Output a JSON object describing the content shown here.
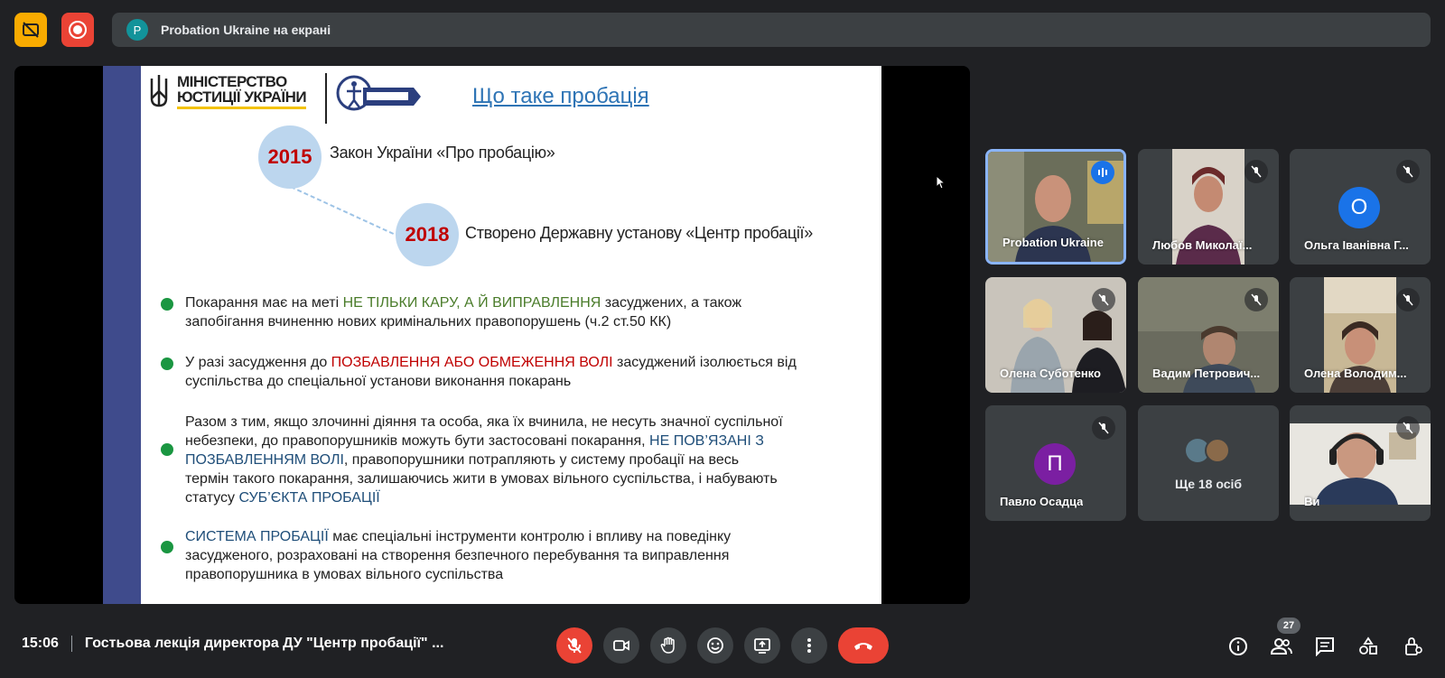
{
  "top_bar": {
    "presenter_initial": "P",
    "presenting_text": "Probation Ukraine на екрані"
  },
  "slide": {
    "ministry_line1": "МІНІСТЕРСТВО",
    "ministry_line2": "ЮСТИЦІЇ УКРАЇНИ",
    "title": "Що таке пробація",
    "timeline": [
      {
        "year": "2015",
        "text": "Закон України «Про пробацію»"
      },
      {
        "year": "2018",
        "text": "Створено Державну установу «Центр пробації»"
      }
    ],
    "bullet1": {
      "a": "Покарання має на меті ",
      "b": "НЕ ТІЛЬКИ КАРУ, А Й ВИПРАВЛЕННЯ",
      "c": " засуджених, а також",
      "d": "запобігання вчиненню нових кримінальних правопорушень (ч.2 ст.50 КК)"
    },
    "bullet2": {
      "a": "У разі засудження до ",
      "b": "ПОЗБАВЛЕННЯ АБО ОБМЕЖЕННЯ ВОЛІ",
      "c": " засуджений ізолюється від",
      "d": "суспільства до спеціальної установи виконання покарань"
    },
    "bullet3": {
      "l1": "Разом з тим, якщо злочинні діяння та особа, яка їх вчинила, не несуть значної суспільної",
      "l2a": "небезпеки, до правопорушників можуть бути застосовані покарання, ",
      "l2b": "НЕ ПОВ’ЯЗАНІ З",
      "l3a": "ПОЗБАВЛЕННЯМ ВОЛІ",
      "l3b": ", правопорушники потрапляють у систему пробації на весь",
      "l4": "термін такого покарання, залишаючись жити в умовах вільного суспільства, і набувають",
      "l5a": "статусу ",
      "l5b": "СУБ’ЄКТА ПРОБАЦІЇ"
    },
    "bullet4": {
      "a": "СИСТЕМА ПРОБАЦІЇ",
      "b": " має спеціальні інструменти контролю і впливу на поведінку",
      "l2": "засудженого, розраховані на створення безпечного перебування та виправлення",
      "l3": "правопорушника в умовах вільного суспільства"
    }
  },
  "participants": [
    {
      "name": "Probation Ukraine"
    },
    {
      "name": "Любов Миколаї..."
    },
    {
      "name": "Ольга Іванівна Г...",
      "initial": "О",
      "color": "#1a73e8"
    },
    {
      "name": "Олена Суботенко"
    },
    {
      "name": "Вадим Петрович..."
    },
    {
      "name": "Олена Володим..."
    },
    {
      "name": "Павло Осадца",
      "initial": "П",
      "color": "#7b1fa2"
    },
    {
      "name": "Ще 18 осіб"
    },
    {
      "name": "Ви"
    }
  ],
  "bottom_bar": {
    "time": "15:06",
    "meeting_title": "Гостьова лекція директора ДУ \"Центр пробації\" ...",
    "participant_count": "27"
  },
  "colors": {
    "background": "#202124",
    "accent": "#8ab4f8",
    "danger": "#ea4335",
    "warning": "#f9ab00"
  }
}
